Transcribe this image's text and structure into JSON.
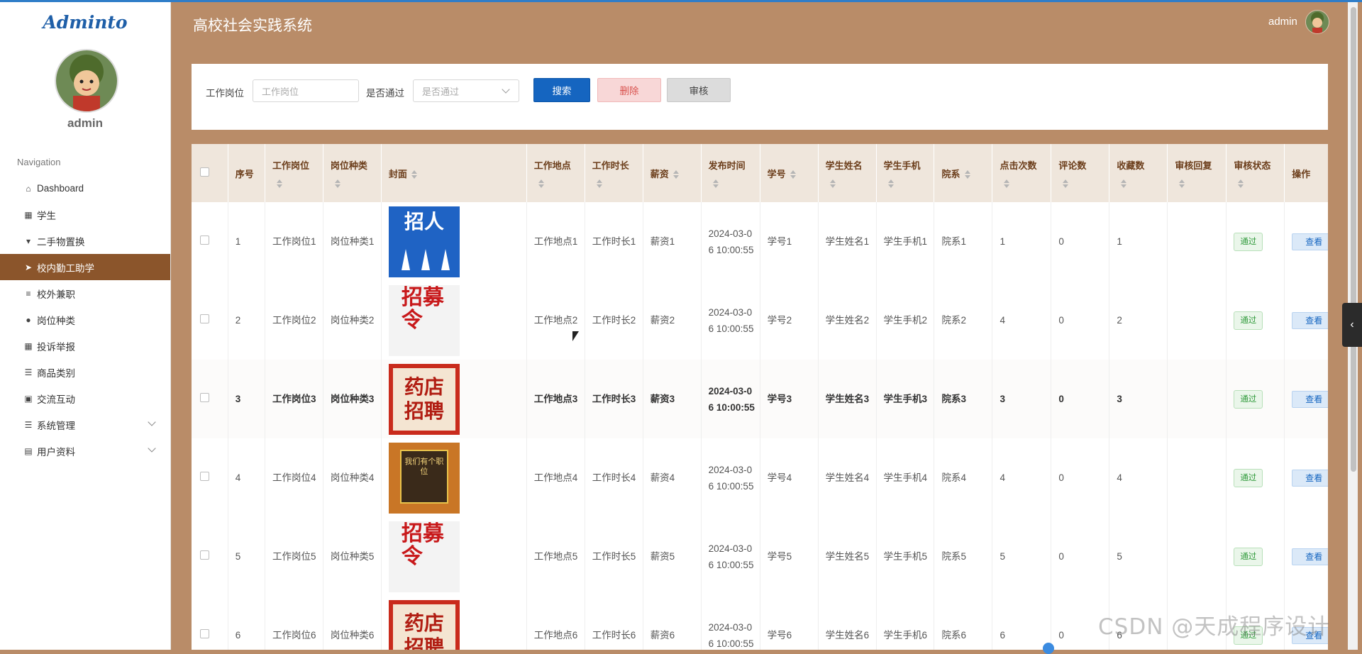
{
  "sidebar": {
    "logo": "Adminto",
    "username": "admin",
    "nav_title": "Navigation",
    "items": [
      {
        "label": "Dashboard",
        "icon": "home-icon",
        "glyph": "⌂"
      },
      {
        "label": "学生",
        "icon": "grid-icon",
        "glyph": "▦"
      },
      {
        "label": "二手物置换",
        "icon": "sign-icon",
        "glyph": "▾"
      },
      {
        "label": "校内勤工助学",
        "icon": "send-icon",
        "glyph": "➤"
      },
      {
        "label": "校外兼职",
        "icon": "sliders-icon",
        "glyph": "≡"
      },
      {
        "label": "岗位种类",
        "icon": "bulb-icon",
        "glyph": "●"
      },
      {
        "label": "投诉举报",
        "icon": "grid-icon",
        "glyph": "▦"
      },
      {
        "label": "商品类别",
        "icon": "list-icon",
        "glyph": "☰"
      },
      {
        "label": "交流互动",
        "icon": "chip-icon",
        "glyph": "▣"
      },
      {
        "label": "系统管理",
        "icon": "list-icon",
        "glyph": "☰"
      },
      {
        "label": "用户资料",
        "icon": "calendar-icon",
        "glyph": "▤"
      }
    ]
  },
  "header": {
    "title": "高校社会实践系统",
    "username": "admin"
  },
  "search": {
    "position_label": "工作岗位",
    "position_placeholder": "工作岗位",
    "pass_label": "是否通过",
    "pass_placeholder": "是否通过",
    "search_button": "搜索",
    "delete_button": "删除",
    "audit_button": "审核"
  },
  "table": {
    "headers": [
      "序号",
      "工作岗位",
      "岗位种类",
      "封面",
      "工作地点",
      "工作时长",
      "薪资",
      "发布时间",
      "学号",
      "学生姓名",
      "学生手机",
      "院系",
      "点击次数",
      "评论数",
      "收藏数",
      "审核回复",
      "审核状态",
      "操作"
    ],
    "rows": [
      {
        "no": "1",
        "position": "工作岗位1",
        "category": "岗位种类1",
        "cover": "招人",
        "location": "工作地点1",
        "duration": "工作时长1",
        "salary": "薪资1",
        "time": "2024-03-06 10:00:55",
        "sid": "学号1",
        "name": "学生姓名1",
        "phone": "学生手机1",
        "dept": "院系1",
        "clicks": "1",
        "comments": "0",
        "favs": "1",
        "reply": "",
        "status": "通过",
        "view": "查看",
        "more": "查"
      },
      {
        "no": "2",
        "position": "工作岗位2",
        "category": "岗位种类2",
        "cover": "招募令",
        "location": "工作地点2",
        "duration": "工作时长2",
        "salary": "薪资2",
        "time": "2024-03-06 10:00:55",
        "sid": "学号2",
        "name": "学生姓名2",
        "phone": "学生手机2",
        "dept": "院系2",
        "clicks": "4",
        "comments": "0",
        "favs": "2",
        "reply": "",
        "status": "通过",
        "view": "查看",
        "more": "查"
      },
      {
        "no": "3",
        "position": "工作岗位3",
        "category": "岗位种类3",
        "cover": "药店招聘",
        "location": "工作地点3",
        "duration": "工作时长3",
        "salary": "薪资3",
        "time": "2024-03-06 10:00:55",
        "sid": "学号3",
        "name": "学生姓名3",
        "phone": "学生手机3",
        "dept": "院系3",
        "clicks": "3",
        "comments": "0",
        "favs": "3",
        "reply": "",
        "status": "通过",
        "view": "查看",
        "more": "查"
      },
      {
        "no": "4",
        "position": "工作岗位4",
        "category": "岗位种类4",
        "cover": "我们有个职位",
        "location": "工作地点4",
        "duration": "工作时长4",
        "salary": "薪资4",
        "time": "2024-03-06 10:00:55",
        "sid": "学号4",
        "name": "学生姓名4",
        "phone": "学生手机4",
        "dept": "院系4",
        "clicks": "4",
        "comments": "0",
        "favs": "4",
        "reply": "",
        "status": "通过",
        "view": "查看",
        "more": "查"
      },
      {
        "no": "5",
        "position": "工作岗位5",
        "category": "岗位种类5",
        "cover": "招募令",
        "location": "工作地点5",
        "duration": "工作时长5",
        "salary": "薪资5",
        "time": "2024-03-06 10:00:55",
        "sid": "学号5",
        "name": "学生姓名5",
        "phone": "学生手机5",
        "dept": "院系5",
        "clicks": "5",
        "comments": "0",
        "favs": "5",
        "reply": "",
        "status": "通过",
        "view": "查看",
        "more": "查"
      },
      {
        "no": "6",
        "position": "工作岗位6",
        "category": "岗位种类6",
        "cover": "药店招聘",
        "location": "工作地点6",
        "duration": "工作时长6",
        "salary": "薪资6",
        "time": "2024-03-06 10:00:55",
        "sid": "学号6",
        "name": "学生姓名6",
        "phone": "学生手机6",
        "dept": "院系6",
        "clicks": "6",
        "comments": "0",
        "favs": "6",
        "reply": "",
        "status": "通过",
        "view": "查看",
        "more": "查"
      }
    ]
  },
  "watermark": "CSDN @天成程序设计",
  "colors": {
    "brown_bg": "#b98c68",
    "active_nav": "#8b552b",
    "primary": "#1565c0",
    "header_text": "#6b3d1a"
  }
}
